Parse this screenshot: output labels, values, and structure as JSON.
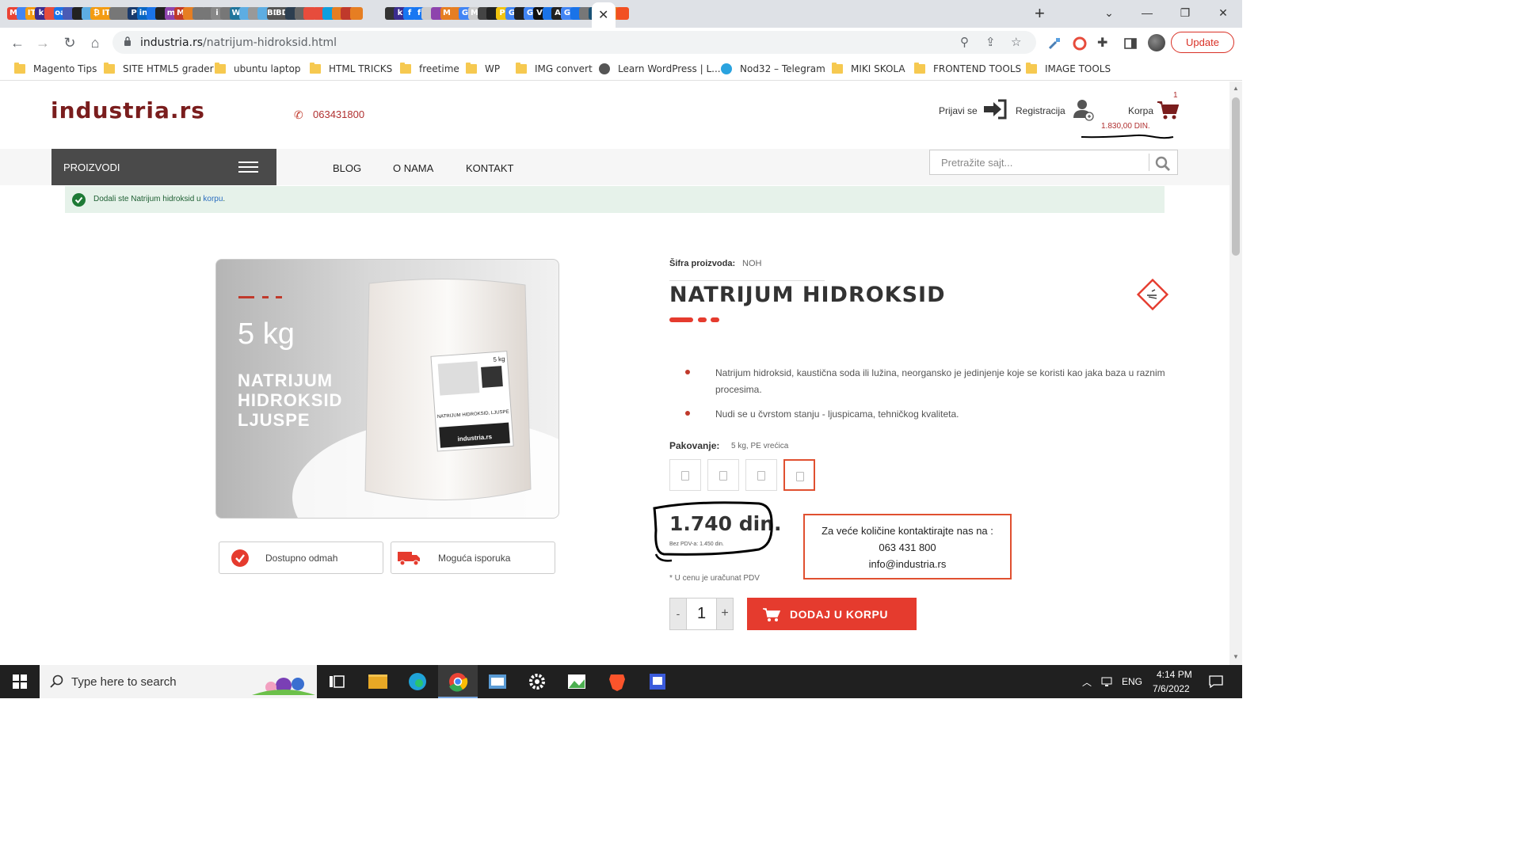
{
  "browser": {
    "url_domain": "industria.rs",
    "url_path": "/natrijum-hidroksid.html",
    "update_label": "Update",
    "tab_favicons": [
      {
        "label": "M",
        "color": "#ea4335"
      },
      {
        "label": "",
        "color": "#4285f4"
      },
      {
        "label": "IT",
        "color": "#f39c12"
      },
      {
        "label": "k",
        "color": "#3b2d8f"
      },
      {
        "label": "",
        "color": "#e74c3c"
      },
      {
        "label": "oa",
        "color": "#1a73e8"
      },
      {
        "label": "",
        "color": "#4a5bb5"
      },
      {
        "label": "",
        "color": "#222222"
      },
      {
        "label": "",
        "color": "#5dade2"
      },
      {
        "label": "₿",
        "color": "#f39c12"
      },
      {
        "label": "IT",
        "color": "#f39c12"
      },
      {
        "label": "",
        "color": "#777777"
      },
      {
        "label": "",
        "color": "#777777"
      },
      {
        "label": "P",
        "color": "#1a3a6b"
      },
      {
        "label": "in",
        "color": "#0a66c2"
      },
      {
        "label": "",
        "color": "#1a73e8"
      },
      {
        "label": "",
        "color": "#222222"
      },
      {
        "label": "m",
        "color": "#8e44ad"
      },
      {
        "label": "M",
        "color": "#c0392b"
      },
      {
        "label": "",
        "color": "#e67e22"
      },
      {
        "label": "",
        "color": "#777777"
      },
      {
        "label": "",
        "color": "#777777"
      },
      {
        "label": "i",
        "color": "#888888"
      },
      {
        "label": "",
        "color": "#777777"
      },
      {
        "label": "W",
        "color": "#21759b"
      },
      {
        "label": "",
        "color": "#5dade2"
      },
      {
        "label": "",
        "color": "#999999"
      },
      {
        "label": "",
        "color": "#5dade2"
      },
      {
        "label": "BD",
        "color": "#555555"
      },
      {
        "label": "BD",
        "color": "#555555"
      },
      {
        "label": "",
        "color": "#2c3e50"
      },
      {
        "label": "",
        "color": "#666666"
      },
      {
        "label": "",
        "color": "#e74c3c"
      },
      {
        "label": "",
        "color": "#e74c3c"
      },
      {
        "label": "",
        "color": "#0e9fde"
      },
      {
        "label": "",
        "color": "#e67e22"
      },
      {
        "label": "",
        "color": "#c0392b"
      },
      {
        "label": "",
        "color": "#e67e22"
      },
      {
        "label": "",
        "color": "#333333"
      },
      {
        "label": "k",
        "color": "#3b2d8f"
      },
      {
        "label": "f",
        "color": "#1877f2"
      },
      {
        "label": "f",
        "color": "#1877f2"
      },
      {
        "label": "",
        "color": "#cccccc"
      },
      {
        "label": "",
        "color": "#8e44ad"
      },
      {
        "label": "M",
        "color": "#e67e22"
      },
      {
        "label": "",
        "color": "#e67e22"
      },
      {
        "label": "G",
        "color": "#4285f4"
      },
      {
        "label": "M",
        "color": "#cccccc"
      },
      {
        "label": "",
        "color": "#444444"
      },
      {
        "label": "",
        "color": "#222222"
      },
      {
        "label": "P",
        "color": "#f1c40f"
      },
      {
        "label": "G",
        "color": "#4285f4"
      },
      {
        "label": "",
        "color": "#222222"
      },
      {
        "label": "G",
        "color": "#4285f4"
      },
      {
        "label": "V",
        "color": "#111111"
      },
      {
        "label": "",
        "color": "#1a73e8"
      },
      {
        "label": "A",
        "color": "#222222"
      },
      {
        "label": "G",
        "color": "#4285f4"
      },
      {
        "label": "",
        "color": "#1a73e8"
      },
      {
        "label": "",
        "color": "#777777"
      },
      {
        "label": "D",
        "color": "#1a5276"
      },
      {
        "label": "",
        "color": "#27ae60"
      },
      {
        "label": "",
        "color": "#e67e22"
      },
      {
        "label": "",
        "color": "#f25022"
      }
    ]
  },
  "bookmarks": [
    {
      "label": "Magento Tips",
      "type": "folder"
    },
    {
      "label": "SITE HTML5 grader",
      "type": "folder"
    },
    {
      "label": "ubuntu laptop",
      "type": "folder"
    },
    {
      "label": "HTML TRICKS",
      "type": "folder"
    },
    {
      "label": "freetime",
      "type": "folder"
    },
    {
      "label": "WP",
      "type": "folder"
    },
    {
      "label": "IMG convert",
      "type": "folder"
    },
    {
      "label": "Learn WordPress | L...",
      "type": "globe"
    },
    {
      "label": "Nod32 – Telegram",
      "type": "telegram"
    },
    {
      "label": "MIKI SKOLA",
      "type": "folder"
    },
    {
      "label": "FRONTEND TOOLS",
      "type": "folder"
    },
    {
      "label": "IMAGE TOOLS",
      "type": "folder"
    }
  ],
  "site": {
    "logo": "industria.rs",
    "phone": "063431800",
    "login_label": "Prijavi se",
    "register_label": "Registracija",
    "cart_label": "Korpa",
    "cart_count": "1",
    "cart_total": "1.830,00 DIN.",
    "menu": {
      "products_label": "PROIZVODI",
      "links": [
        "BLOG",
        "O NAMA",
        "KONTAKT"
      ]
    },
    "search_placeholder": "Pretražite sajt...",
    "notice": {
      "text": "Dodali ste Natrijum hidroksid u ",
      "link": "korpu",
      "end": "."
    }
  },
  "product": {
    "image": {
      "weight": "5 kg",
      "title_lines": [
        "NATRIJUM",
        "HIDROKSID",
        "LJUSPE"
      ],
      "bag_label": "industria.rs",
      "bag_product": "NATRIJUM HIDROKSID, LJUSPE",
      "bag_weight": "5 kg"
    },
    "badges": [
      "Dostupno odmah",
      "Moguća isporuka"
    ],
    "sku_label": "Šifra proizvoda:",
    "sku": "NOH",
    "title": "NATRIJUM HIDROKSID",
    "description": [
      "Natrijum hidroksid, kaustična soda ili lužina, neorgansko je jedinjenje koje se koristi kao jaka baza u raznim procesima.",
      "Nudi se u čvrstom stanju - ljuspicama, tehničkog kvaliteta."
    ],
    "packaging_label": "Pakovanje:",
    "packaging_value": "5 kg, PE vrećica",
    "packaging_options_count": 4,
    "price": "1.740 din.",
    "price_net": "Bez PDV-a: 1.450 din.",
    "vat_note": "* U cenu je uračunat PDV",
    "contact": {
      "title": "Za veće količine kontaktirajte nas na :",
      "phone": "063 431 800",
      "email": "info@industria.rs"
    },
    "quantity": "1",
    "qty_minus": "-",
    "qty_plus": "+",
    "add_to_cart": "DODAJ U KORPU"
  },
  "taskbar": {
    "search_text": "Type here to search",
    "language": "ENG",
    "time": "4:14 PM",
    "date": "7/6/2022"
  },
  "colors": {
    "brand": "#7a1d1d",
    "accent": "#e53b2e",
    "notice_bg": "#e6f2ea"
  }
}
